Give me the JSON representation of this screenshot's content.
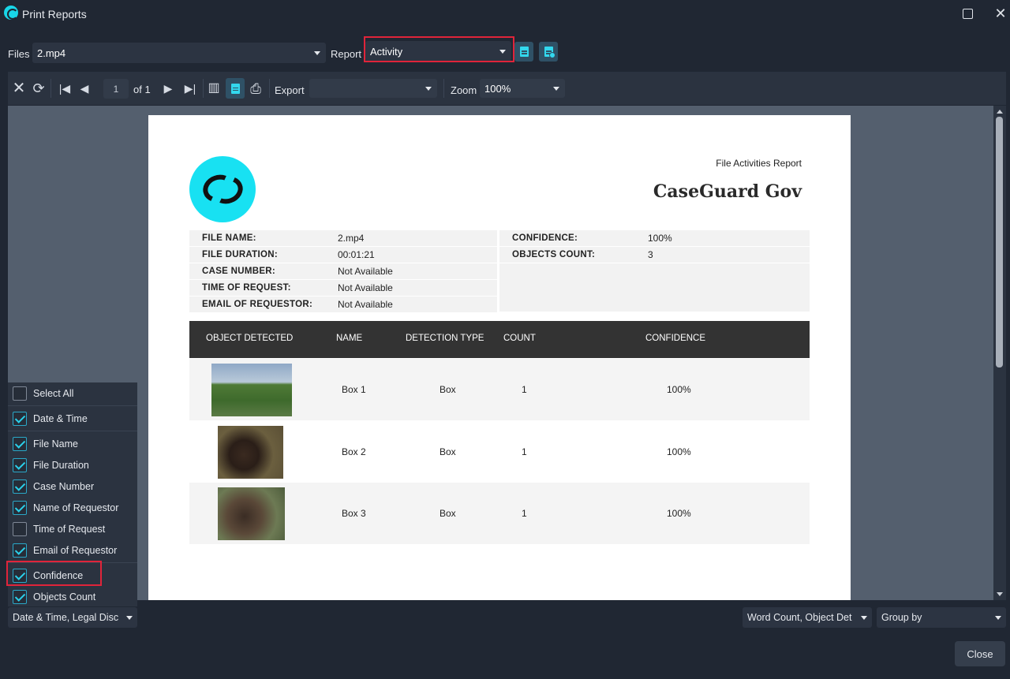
{
  "window": {
    "title": "Print Reports"
  },
  "files": {
    "label": "Files",
    "value": "2.mp4"
  },
  "report": {
    "label": "Report",
    "value": "Activity"
  },
  "toolbar": {
    "page_current": "1",
    "page_total": "of 1",
    "export_label": "Export",
    "export_value": "",
    "zoom_label": "Zoom",
    "zoom_value": "100%"
  },
  "document": {
    "report_title": "File Activities Report",
    "brand": "CaseGuard Gov",
    "info_left": [
      {
        "key": "FILE NAME:",
        "value": "2.mp4"
      },
      {
        "key": "FILE DURATION:",
        "value": "00:01:21"
      },
      {
        "key": "CASE NUMBER:",
        "value": "Not Available"
      },
      {
        "key": "TIME OF REQUEST:",
        "value": "Not Available"
      },
      {
        "key": "EMAIL OF REQUESTOR:",
        "value": "Not Available"
      }
    ],
    "info_right": [
      {
        "key": "CONFIDENCE:",
        "value": "100%"
      },
      {
        "key": "OBJECTS COUNT:",
        "value": "3"
      }
    ],
    "table_headers": [
      "OBJECT DETECTED",
      "NAME",
      "DETECTION TYPE",
      "COUNT",
      "CONFIDENCE"
    ],
    "table_rows": [
      {
        "name": "Box 1",
        "type": "Box",
        "count": "1",
        "confidence": "100%"
      },
      {
        "name": "Box 2",
        "type": "Box",
        "count": "1",
        "confidence": "100%"
      },
      {
        "name": "Box 3",
        "type": "Box",
        "count": "1",
        "confidence": "100%"
      }
    ]
  },
  "fields_panel": {
    "items": [
      {
        "label": "Select All",
        "checked": false
      },
      {
        "label": "Date & Time",
        "checked": true
      },
      {
        "label": "File Name",
        "checked": true
      },
      {
        "label": "File Duration",
        "checked": true
      },
      {
        "label": "Case Number",
        "checked": true
      },
      {
        "label": "Name of Requestor",
        "checked": true
      },
      {
        "label": "Time of Request",
        "checked": false
      },
      {
        "label": "Email of Requestor",
        "checked": true
      },
      {
        "label": "Confidence",
        "checked": true
      },
      {
        "label": "Objects Count",
        "checked": true
      }
    ],
    "summary": "Date & Time, Legal Disc"
  },
  "bottom": {
    "columns_value": "Word Count, Object Det",
    "group_by": "Group by",
    "close_label": "Close"
  },
  "colors": {
    "accent": "#18e1f2",
    "highlight": "#e0243a",
    "background": "#202733"
  }
}
